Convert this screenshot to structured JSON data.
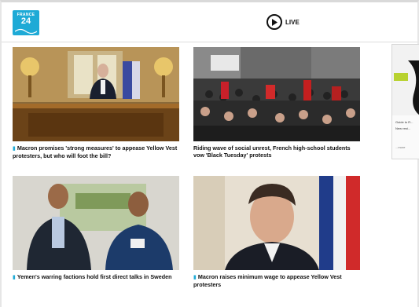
{
  "header": {
    "logo_line1": "FRANCE",
    "logo_line2": "24",
    "live_label": "LIVE"
  },
  "articles": [
    {
      "title": "Macron promises 'strong measures' to appease Yellow Vest protesters, but who will foot the bill?",
      "has_video_marker": true
    },
    {
      "title": "Riding wave of social unrest, French high-school students vow 'Black Tuesday' protests",
      "has_video_marker": false
    },
    {
      "title": "Yemen's warring factions hold first direct talks in Sweden",
      "has_video_marker": true
    },
    {
      "title": "Macron raises minimum wage to appease Yellow Vest protesters",
      "has_video_marker": true
    }
  ],
  "ad": {
    "line1": "Guide to R...",
    "line2": "New rest...",
    "line3": "...more"
  },
  "colors": {
    "brand": "#1eaad6",
    "caption_marker": "#1eaad6"
  },
  "icons": [
    "france24-logo",
    "play-icon",
    "video-marker-icon"
  ]
}
